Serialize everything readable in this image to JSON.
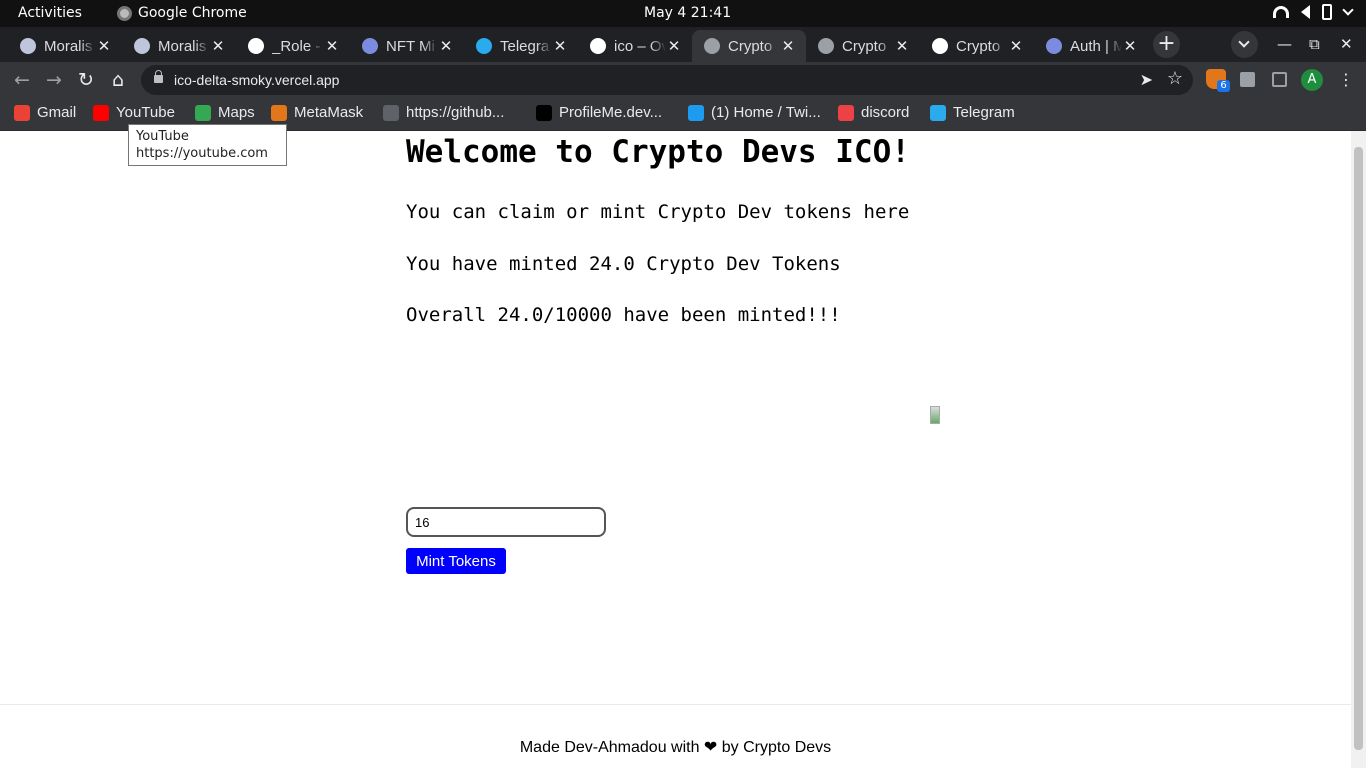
{
  "desktop": {
    "activities": "Activities",
    "app_name": "Google Chrome",
    "clock": "May 4  21:41"
  },
  "tabs": [
    {
      "title": "Moralis",
      "icon": "moralis-icon",
      "active": false
    },
    {
      "title": "Moralis",
      "icon": "moralis-icon",
      "active": false
    },
    {
      "title": "_Role - (",
      "icon": "github-icon",
      "active": false
    },
    {
      "title": "NFT Mi",
      "icon": "hex-icon",
      "active": false
    },
    {
      "title": "Telegra",
      "icon": "telegram-icon",
      "active": false
    },
    {
      "title": "ico – Ov",
      "icon": "vercel-icon",
      "active": false
    },
    {
      "title": "Crypto",
      "icon": "globe-icon",
      "active": true
    },
    {
      "title": "Crypto",
      "icon": "globe-icon",
      "active": false
    },
    {
      "title": "Crypto",
      "icon": "vercel-icon",
      "active": false
    },
    {
      "title": "Auth | M",
      "icon": "hex-icon",
      "active": false
    }
  ],
  "toolbar": {
    "url": "ico-delta-smoky.vercel.app",
    "extension_badge": "6",
    "profile_initial": "A"
  },
  "bookmarks": [
    {
      "label": "Gmail",
      "icon": "gmail-icon",
      "color": "#ea4335"
    },
    {
      "label": "YouTube",
      "icon": "youtube-icon",
      "color": "#ff0000"
    },
    {
      "label": "Maps",
      "icon": "maps-icon",
      "color": "#34a853"
    },
    {
      "label": "MetaMask",
      "icon": "metamask-icon",
      "color": "#e2761b"
    },
    {
      "label": "https://github...",
      "icon": "globe-icon",
      "color": "#5f6368"
    },
    {
      "label": "ProfileMe.dev...",
      "icon": "profileme-icon",
      "color": "#000000"
    },
    {
      "label": "(1) Home / Twi...",
      "icon": "twitter-icon",
      "color": "#1d9bf0"
    },
    {
      "label": "discord",
      "icon": "discord-icon",
      "color": "#ed4245"
    },
    {
      "label": "Telegram",
      "icon": "telegram-icon",
      "color": "#2aabee"
    }
  ],
  "tooltip": {
    "title": "YouTube",
    "url": "https://youtube.com"
  },
  "page": {
    "heading": "Welcome to Crypto Devs ICO!",
    "subtitle": "You can claim or mint Crypto Dev tokens here",
    "minted_text": "You have minted 24.0 Crypto Dev Tokens",
    "overall_text": "Overall 24.0/10000 have been minted!!!",
    "amount_value": "16",
    "mint_button": "Mint Tokens",
    "footer": "Made Dev-Ahmadou with ❤ by Crypto Devs"
  },
  "colors": {
    "mint_button": "#0000ff",
    "tab_bar": "#202124",
    "toolbar": "#35363a"
  }
}
